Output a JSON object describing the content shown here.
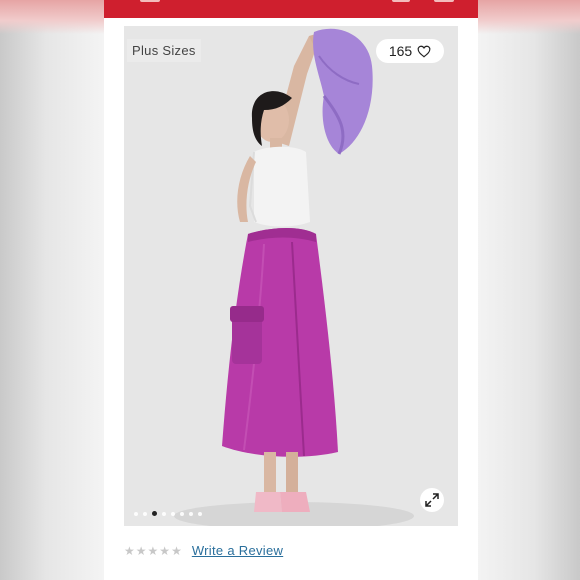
{
  "product_image": {
    "badge": "Plus Sizes",
    "favorites_count": "165",
    "carousel_dot_count": 8,
    "carousel_active_index": 2
  },
  "reviews": {
    "rating": 0,
    "max_rating": 5,
    "write_review_label": "Write a Review"
  },
  "colors": {
    "header_red": "#cf1f2e",
    "skirt_magenta": "#b83aa8",
    "jacket_lilac": "#a685d8",
    "link_blue": "#2a6f9c"
  }
}
